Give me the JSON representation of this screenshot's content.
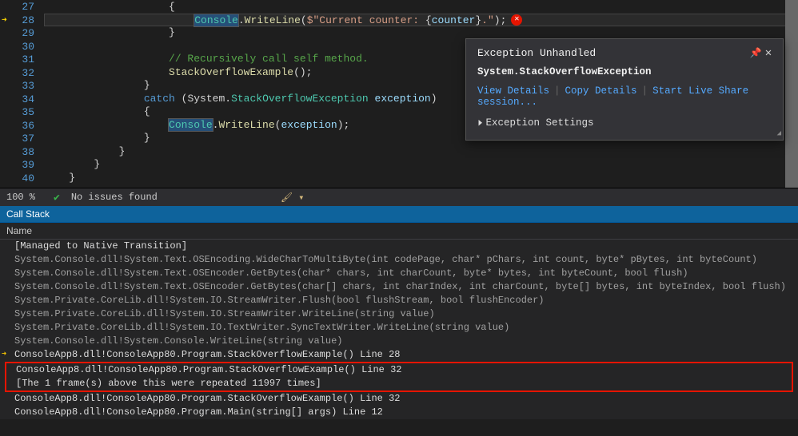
{
  "editor": {
    "lines": [
      {
        "n": 27,
        "indent": "                    ",
        "raw": "{"
      },
      {
        "n": 28,
        "indent": "                        ",
        "highlight": true
      },
      {
        "n": 29,
        "indent": "                    ",
        "raw": "}"
      },
      {
        "n": 30,
        "indent": "",
        "raw": ""
      },
      {
        "n": 31,
        "indent": "                    ",
        "comment": "// Recursively call self method."
      },
      {
        "n": 32,
        "indent": "                    ",
        "call": "StackOverflowExample",
        "after": "();"
      },
      {
        "n": 33,
        "indent": "                ",
        "raw": "}"
      },
      {
        "n": 34,
        "indent": "                ",
        "catchline": true
      },
      {
        "n": 35,
        "indent": "                ",
        "raw": "{"
      },
      {
        "n": 36,
        "indent": "                    "
      },
      {
        "n": 37,
        "indent": "                ",
        "raw": "}"
      },
      {
        "n": 38,
        "indent": "            ",
        "raw": "}"
      },
      {
        "n": 39,
        "indent": "        ",
        "raw": "}"
      },
      {
        "n": 40,
        "indent": "    ",
        "raw": "}"
      }
    ],
    "line28": {
      "type": "Console",
      "method": "WriteLine",
      "str_prefix": "$\"",
      "str_body": "Current counter: ",
      "interp_open": "{",
      "interp_var": "counter",
      "interp_close": "}",
      "str_suffix": ".\"",
      "after": ");"
    },
    "line34": {
      "kw": "catch",
      "open": " (",
      "ns": "System.",
      "type": "StackOverflowException",
      "space": " ",
      "var": "exception",
      "close": ")"
    },
    "line36": {
      "type": "Console",
      "method": "WriteLine",
      "open": "(",
      "var": "exception",
      "close": ");"
    }
  },
  "popup": {
    "title": "Exception Unhandled",
    "exception_type": "System.StackOverflowException",
    "links": [
      "View Details",
      "Copy Details",
      "Start Live Share session..."
    ],
    "settings_label": "Exception Settings"
  },
  "statusbar": {
    "zoom": "100 %",
    "issues": "No issues found"
  },
  "callstack": {
    "title": "Call Stack",
    "col": "Name",
    "rows": [
      {
        "t": "[Managed to Native Transition]",
        "b": true
      },
      {
        "t": "System.Console.dll!System.Text.OSEncoding.WideCharToMultiByte(int codePage, char* pChars, int count, byte* pBytes, int byteCount)"
      },
      {
        "t": "System.Console.dll!System.Text.OSEncoder.GetBytes(char* chars, int charCount, byte* bytes, int byteCount, bool flush)"
      },
      {
        "t": "System.Console.dll!System.Text.OSEncoder.GetBytes(char[] chars, int charIndex, int charCount, byte[] bytes, int byteIndex, bool flush)"
      },
      {
        "t": "System.Private.CoreLib.dll!System.IO.StreamWriter.Flush(bool flushStream, bool flushEncoder)"
      },
      {
        "t": "System.Private.CoreLib.dll!System.IO.StreamWriter.WriteLine(string value)"
      },
      {
        "t": "System.Private.CoreLib.dll!System.IO.TextWriter.SyncTextWriter.WriteLine(string value)"
      },
      {
        "t": "System.Console.dll!System.Console.WriteLine(string value)"
      },
      {
        "t": "ConsoleApp8.dll!ConsoleApp80.Program.StackOverflowExample() Line 28",
        "b": true,
        "arrow": true
      },
      {
        "t": "ConsoleApp8.dll!ConsoleApp80.Program.StackOverflowExample() Line 32",
        "b": true,
        "boxStart": true
      },
      {
        "t": "[The 1 frame(s) above this were repeated 11997 times]",
        "b": true,
        "boxEnd": true
      },
      {
        "t": "ConsoleApp8.dll!ConsoleApp80.Program.StackOverflowExample() Line 32",
        "b": true
      },
      {
        "t": "ConsoleApp8.dll!ConsoleApp80.Program.Main(string[] args) Line 12",
        "b": true
      }
    ]
  }
}
